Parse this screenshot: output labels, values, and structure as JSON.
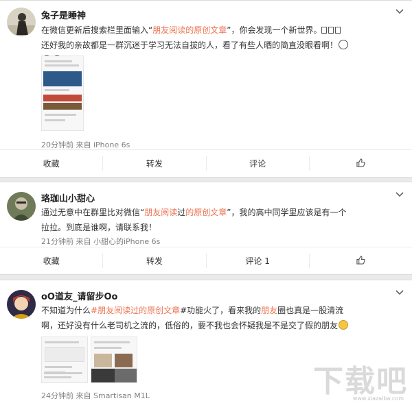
{
  "posts": [
    {
      "author": "兔子是睡神",
      "text_a": "在微信更新后搜索栏里面输入“",
      "text_hl": "朋友阅读的原创文章",
      "text_b": "”，你会发现一个新世界。",
      "text_c": " 还好我的亲故都是一群沉迷于学习无法自拔的人，看了有些人晒的简直没眼看啊！",
      "meta": "20分钟前 来自 iPhone 6s",
      "actions": [
        "收藏",
        "转发",
        "评论",
        ""
      ]
    },
    {
      "author": "珞珈山小甜心",
      "text_a": "通过无意中在群里比对微信“",
      "text_hl1": "朋友阅读",
      "text_mid": "过",
      "text_hl2": "的原创文章",
      "text_b": "”，我的高中同学里应该是有一个拉拉。到底是谁啊，请联系我！",
      "meta": "21分钟前 来自 小甜心的iPhone 6s",
      "actions": [
        "收藏",
        "转发",
        "评论 1",
        ""
      ]
    },
    {
      "author": "oO道友_请留步Oo",
      "text_a": "不知道为什么",
      "text_hl1": "#朋友阅读过",
      "text_hl2": "的原创文章",
      "text_b": "#功能火了，看来我的",
      "text_hl3": "朋友",
      "text_c": "圈也真是一股清流啊，还好没有什么老司机之流的，低俗的，要不我也会怀疑我是不是交了假的朋友",
      "meta": "24分钟前 来自 Smartisan M1L",
      "actions": []
    }
  ],
  "icons": {
    "chevron": "chevron-down-icon",
    "like": "thumbs-up-icon"
  },
  "watermark": {
    "brand": "下载吧",
    "url": "www.xiazaiba.com"
  },
  "colors": {
    "highlight": "#eb7350",
    "meta": "#808080",
    "background": "#eaeaea"
  }
}
